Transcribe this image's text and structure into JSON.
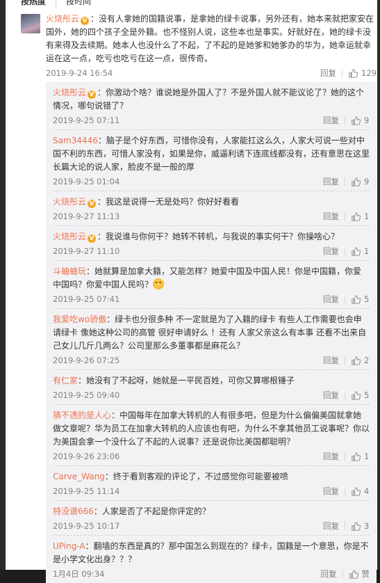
{
  "tabs": {
    "hot": "按热度",
    "time": "按时间"
  },
  "top_comment": {
    "user": "火烧彤云",
    "text": "：没有人拿她的国籍说事，是拿她的绿卡说事，另外还有，她本来就把家安在国外，她的四个孩子全是外籍。也不怪别人说，这些本也是事实。好就好在，她的绿卡没有来得及去续期。她本人也没什么了不起，了不起的是她爹和她爹办的华为，她幸运就幸运在这一点，吃亏也吃亏在这一点，很传奇。",
    "time": "2019-9-24 16:54",
    "reply_label": "回复",
    "likes": "129"
  },
  "replies": [
    {
      "user": "火烧彤云",
      "vip": true,
      "text": "：你激动个啥？谁说她是外国人了？不是外国人就不能议论了？她的这个情况，哪句说错了？",
      "time": "2019-9-25 07:11",
      "reply_label": "回复",
      "likes": "9"
    },
    {
      "user": "Sam34446",
      "vip": false,
      "text": "：脑子是个好东西，可惜你没有，人家能扛这么久，人家大可说一些对中国不利的东西，可惜人家没有，如果是你，威逼利诱下连底线都没有，还有意思在这里长篇大论的说人家，脸皮不是一般的厚",
      "time": "2019-9-25 01:04",
      "reply_label": "回复",
      "likes": "9"
    },
    {
      "user": "火烧彤云",
      "vip": true,
      "text": "：我这是说得一无是处吗？你好好看看",
      "time": "2019-9-27 11:13",
      "reply_label": "回复",
      "likes": "1"
    },
    {
      "user": "火烧彤云",
      "vip": true,
      "text": "：我说谁与你何干？她转不转机，与我说的事实何干？你操啥心？",
      "time": "2019-9-27 11:10",
      "reply_label": "回复",
      "likes": "1"
    },
    {
      "user": "斗蛐蛐玩",
      "vip": false,
      "text": "：她就算是加拿大籍，又能怎样？她爱中国及中国人民！你是中国籍，你爱中国吗？你爱中国人民吗？",
      "emoji": "smile-emoji",
      "time": "2019-9-25 07:41",
      "reply_label": "回复",
      "likes": "5"
    },
    {
      "user": "我爱吃wo骄傲",
      "vip": false,
      "text": "：绿卡也分很多种 不一定就是为了入籍的绿卡 有些人工作需要也会申请绿卡 像她这种公司的高管 很好申请好么 ！还有 人家父亲这么有本事 还看不出来自己女儿几斤几两么？公司里那么多董事都是麻花么？",
      "time": "2019-9-26 07:25",
      "reply_label": "回复",
      "likes": "2"
    },
    {
      "user": "有仁家",
      "vip": false,
      "text": "：她没有了不起呀，她就是一平民百姓，可你又算哪根锤子",
      "time": "2019-9-25 09:40",
      "reply_label": "回复",
      "likes": "5"
    },
    {
      "user": "猜不透的是人心",
      "vip": false,
      "text": "：中国每年在加拿大转机的人有很多吧，但是为什么偏偏美国就拿她做文章呢？华为员工在加拿大转机的人应该也有吧，为什么不拿其他员工说事呢？你以为美国会拿一个没什么了不起的人说事？还是说你比美国都聪明？",
      "time": "2019-9-26 23:06",
      "reply_label": "回复",
      "likes": "1"
    },
    {
      "user": "Carve_Wang",
      "vip": false,
      "text": "：终于看到客观的评论了，不过感觉你可能要被喷",
      "time": "2019-9-25 11:14",
      "reply_label": "回复",
      "likes": "4"
    },
    {
      "user": "特没谱666",
      "vip": false,
      "text": "：人家是否了不起是你评定的？",
      "time": "2019-9-25 10:17",
      "reply_label": "回复",
      "likes": "3"
    },
    {
      "user": "UPing-A",
      "vip": false,
      "text": "：翻墙的东西是真的？那中国怎么到现在的？绿卡，国籍是一个意思，你是不是小学文化出身？？？",
      "time": "1月4日 09:34",
      "reply_label": "回复",
      "likes": "赞"
    }
  ],
  "colors": {
    "username": "#eb7350",
    "meta": "#808080",
    "reply_bg": "#f2f2f5"
  },
  "icons": {
    "vip": "vip-badge-icon",
    "like": "thumb-up-icon",
    "avatar": "avatar-image"
  }
}
